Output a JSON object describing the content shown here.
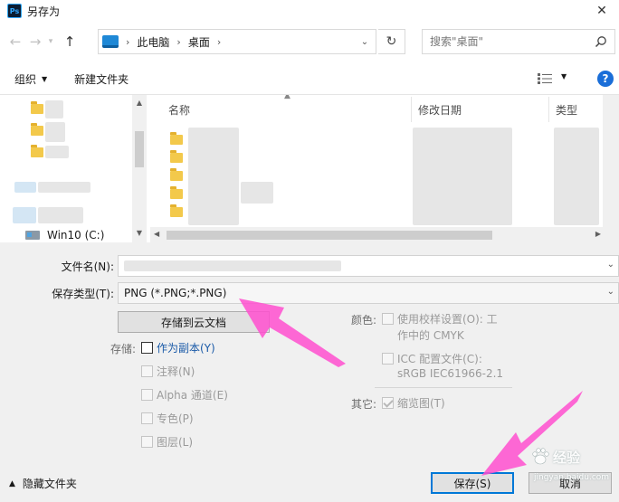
{
  "window": {
    "title": "另存为",
    "app_icon": "Ps"
  },
  "address_bar": {
    "crumbs": [
      "此电脑",
      "桌面"
    ],
    "search_placeholder": "搜索\"桌面\""
  },
  "toolbar": {
    "organize_label": "组织",
    "new_folder_label": "新建文件夹"
  },
  "nav_pane": {
    "drive_label": "Win10 (C:)"
  },
  "file_list": {
    "columns": [
      "名称",
      "修改日期",
      "类型"
    ]
  },
  "fields": {
    "filename_label": "文件名(N):",
    "filetype_label": "保存类型(T):",
    "filetype_value": "PNG (*.PNG;*.PNG)"
  },
  "options": {
    "cloud_button": "存储到云文档",
    "save_label": "存储:",
    "as_copy": "作为副本(Y)",
    "notes": "注释(N)",
    "alpha": "Alpha 通道(E)",
    "spot": "专色(P)",
    "layers": "图层(L)",
    "color_label": "颜色:",
    "proof_line1": "使用校样设置(O): 工",
    "proof_line2": "作中的 CMYK",
    "icc_line1": "ICC 配置文件(C):",
    "icc_line2": "sRGB IEC61966-2.1",
    "other_label": "其它:",
    "thumbnail": "缩览图(T)"
  },
  "footer": {
    "hide_folders": "隐藏文件夹",
    "save_button": "保存(S)",
    "cancel_button": "取消"
  },
  "watermark": {
    "brand": "经验",
    "sub": "jingyan.baidu.com"
  },
  "colors": {
    "accent": "#0078d7",
    "annotation": "#ff4fcf",
    "help": "#1a6ed8"
  }
}
